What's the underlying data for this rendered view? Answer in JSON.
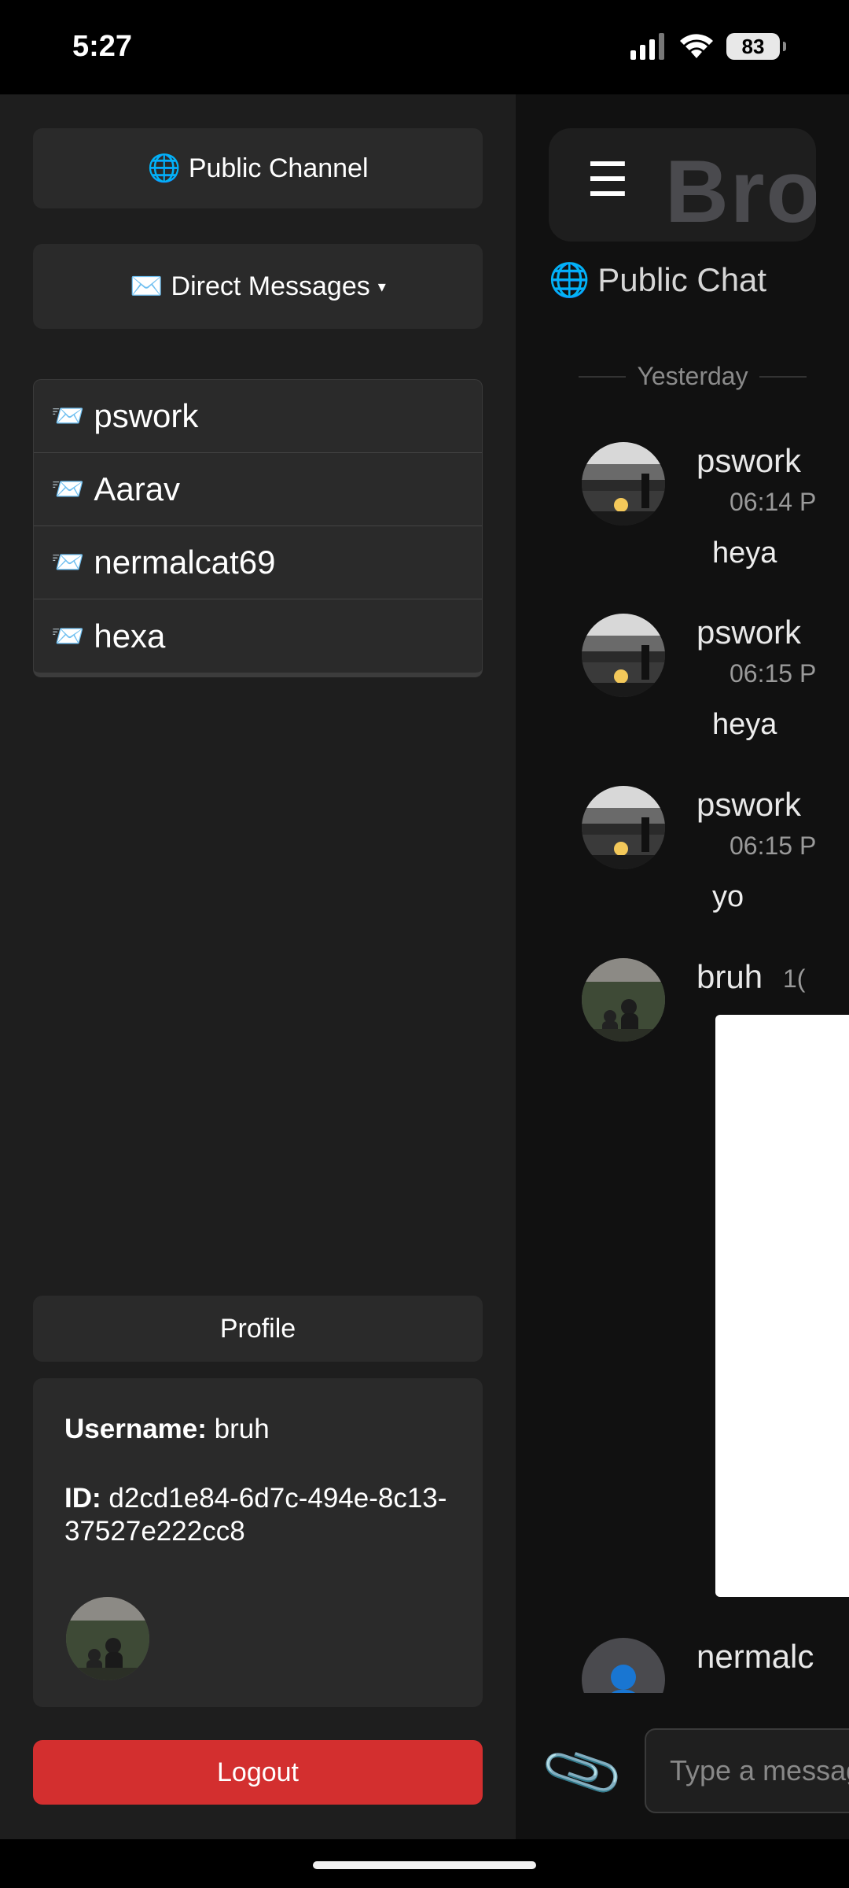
{
  "status_bar": {
    "time": "5:27",
    "battery": "83"
  },
  "sidebar": {
    "public_channel": {
      "emoji": "🌐",
      "label": "Public Channel"
    },
    "direct_messages": {
      "emoji": "✉️",
      "label": "Direct Messages",
      "caret": "▾"
    },
    "dm_items": [
      {
        "icon": "📨",
        "name": "pswork"
      },
      {
        "icon": "📨",
        "name": "Aarav"
      },
      {
        "icon": "📨",
        "name": "nermalcat69"
      },
      {
        "icon": "📨",
        "name": "hexa"
      }
    ],
    "profile_button": "Profile",
    "profile": {
      "username_label": "Username:",
      "username": "bruh",
      "id_label": "ID:",
      "id": "d2cd1e84-6d7c-494e-8c13-37527e222cc8"
    },
    "logout_button": "Logout"
  },
  "chat": {
    "menu_glyph": "☰",
    "logo_text": "BroC",
    "channel_globe": "🌐",
    "channel_title": "Public Chat",
    "date_separator": "Yesterday",
    "messages": [
      {
        "name": "pswork",
        "time": "06:14 P",
        "text": "heya"
      },
      {
        "name": "pswork",
        "time": "06:15 P",
        "text": "heya"
      },
      {
        "name": "pswork",
        "time": "06:15 P",
        "text": "yo"
      },
      {
        "name": "bruh",
        "time": "1(",
        "text": ""
      },
      {
        "name": "nermalc",
        "time": "",
        "text": ""
      }
    ],
    "input_placeholder": "Type a messag"
  },
  "colors": {
    "sidebar_bg": "#1e1e1e",
    "button_bg": "#2a2a2a",
    "logout": "#d32f2f",
    "chat_bg": "#111111"
  }
}
